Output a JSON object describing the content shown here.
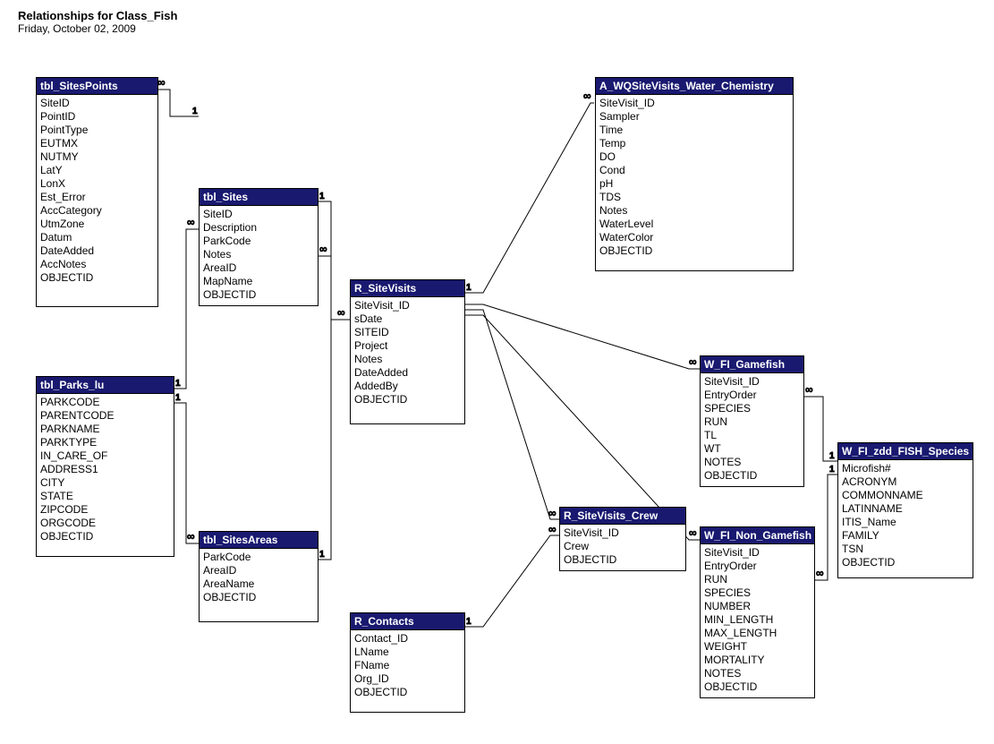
{
  "header": {
    "title": "Relationships for Class_Fish",
    "date": "Friday, October 02, 2009"
  },
  "tables": {
    "sitesPoints": {
      "title": "tbl_SitesPoints",
      "fields": [
        "SiteID",
        "PointID",
        "PointType",
        "EUTMX",
        "NUTMY",
        "LatY",
        "LonX",
        "Est_Error",
        "AccCategory",
        "UtmZone",
        "Datum",
        "DateAdded",
        "AccNotes",
        "OBJECTID"
      ]
    },
    "parksLu": {
      "title": "tbl_Parks_lu",
      "fields": [
        "PARKCODE",
        "PARENTCODE",
        "PARKNAME",
        "PARKTYPE",
        "IN_CARE_OF",
        "ADDRESS1",
        "CITY",
        "STATE",
        "ZIPCODE",
        "ORGCODE",
        "OBJECTID"
      ]
    },
    "sites": {
      "title": "tbl_Sites",
      "fields": [
        "SiteID",
        "Description",
        "ParkCode",
        "Notes",
        "AreaID",
        "MapName",
        "OBJECTID"
      ]
    },
    "sitesAreas": {
      "title": "tbl_SitesAreas",
      "fields": [
        "ParkCode",
        "AreaID",
        "AreaName",
        "OBJECTID"
      ]
    },
    "siteVisits": {
      "title": "R_SiteVisits",
      "fields": [
        "SiteVisit_ID",
        "sDate",
        "SITEID",
        "Project",
        "Notes",
        "DateAdded",
        "AddedBy",
        "OBJECTID"
      ]
    },
    "contacts": {
      "title": "R_Contacts",
      "fields": [
        "Contact_ID",
        "LName",
        "FName",
        "Org_ID",
        "OBJECTID"
      ]
    },
    "siteVisitsCrew": {
      "title": "R_SiteVisits_Crew",
      "fields": [
        "SiteVisit_ID",
        "Crew",
        "OBJECTID"
      ]
    },
    "waterChem": {
      "title": "A_WQSiteVisits_Water_Chemistry",
      "fields": [
        "SiteVisit_ID",
        "Sampler",
        "Time",
        "Temp",
        "DO",
        "Cond",
        "pH",
        "TDS",
        "Notes",
        "WaterLevel",
        "WaterColor",
        "OBJECTID"
      ]
    },
    "gamefish": {
      "title": "W_FI_Gamefish",
      "fields": [
        "SiteVisit_ID",
        "EntryOrder",
        "SPECIES",
        "RUN",
        "TL",
        "WT",
        "NOTES",
        "OBJECTID"
      ]
    },
    "nonGamefish": {
      "title": "W_FI_Non_Gamefish",
      "fields": [
        "SiteVisit_ID",
        "EntryOrder",
        "RUN",
        "SPECIES",
        "NUMBER",
        "MIN_LENGTH",
        "MAX_LENGTH",
        "WEIGHT",
        "MORTALITY",
        "NOTES",
        "OBJECTID"
      ]
    },
    "fishSpecies": {
      "title": "W_FI_zdd_FISH_Species",
      "fields": [
        "Microfish#",
        "ACRONYM",
        "COMMONNAME",
        "LATINNAME",
        "ITIS_Name",
        "FAMILY",
        "TSN",
        "OBJECTID"
      ]
    }
  }
}
